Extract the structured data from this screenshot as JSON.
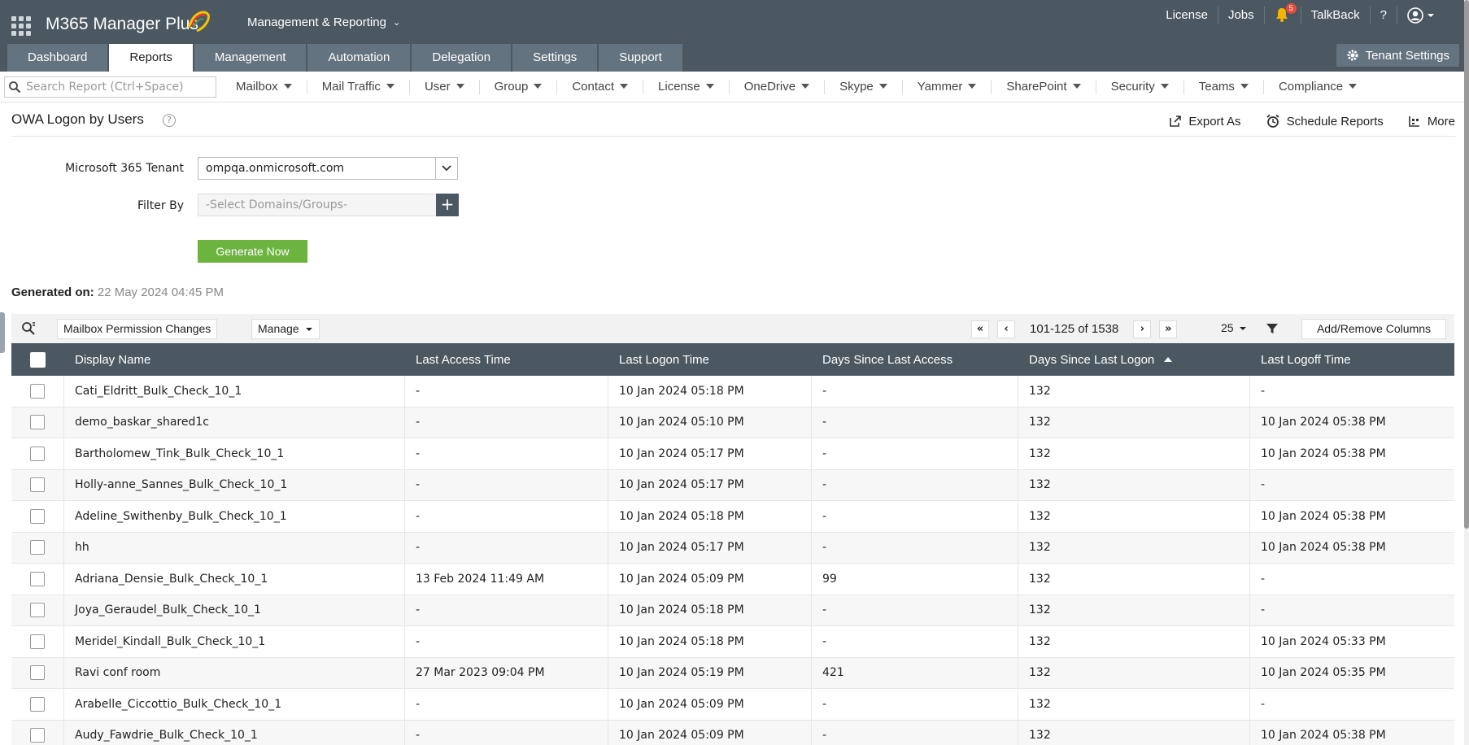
{
  "header": {
    "brand": "M365 Manager Plus",
    "module": "Management & Reporting",
    "links": [
      "License",
      "Jobs",
      "TalkBack",
      "?"
    ],
    "notification_count": "5",
    "tenant_settings": "Tenant Settings"
  },
  "tabs": [
    "Dashboard",
    "Reports",
    "Management",
    "Automation",
    "Delegation",
    "Settings",
    "Support"
  ],
  "subnav": {
    "search_placeholder": "Search Report (Ctrl+Space)",
    "items": [
      "Mailbox",
      "Mail Traffic",
      "User",
      "Group",
      "Contact",
      "License",
      "OneDrive",
      "Skype",
      "Yammer",
      "SharePoint",
      "Security",
      "Teams",
      "Compliance"
    ]
  },
  "page": {
    "title": "OWA Logon by Users",
    "actions": {
      "export": "Export As",
      "schedule": "Schedule Reports",
      "more": "More"
    }
  },
  "form": {
    "tenant_label": "Microsoft 365 Tenant",
    "tenant_value": "ompqa.onmicrosoft.com",
    "filter_label": "Filter By",
    "filter_placeholder": "-Select Domains/Groups-",
    "generate": "Generate Now",
    "generated_label": "Generated on:",
    "generated_value": "22 May 2024 04:45 PM"
  },
  "grid_toolbar": {
    "quick_filter": "Mailbox Permission Changes",
    "manage": "Manage",
    "range": "101-125 of 1538",
    "page_size": "25",
    "add_remove": "Add/Remove Columns"
  },
  "table": {
    "columns": [
      "Display Name",
      "Last Access Time",
      "Last Logon Time",
      "Days Since Last Access",
      "Days Since Last Logon",
      "Last Logoff Time"
    ],
    "rows": [
      [
        "Cati_Eldritt_Bulk_Check_10_1",
        "-",
        "10 Jan 2024 05:18 PM",
        "-",
        "132",
        "-"
      ],
      [
        "demo_baskar_shared1c",
        "-",
        "10 Jan 2024 05:10 PM",
        "-",
        "132",
        "10 Jan 2024 05:38 PM"
      ],
      [
        "Bartholomew_Tink_Bulk_Check_10_1",
        "-",
        "10 Jan 2024 05:17 PM",
        "-",
        "132",
        "10 Jan 2024 05:38 PM"
      ],
      [
        "Holly-anne_Sannes_Bulk_Check_10_1",
        "-",
        "10 Jan 2024 05:17 PM",
        "-",
        "132",
        "-"
      ],
      [
        "Adeline_Swithenby_Bulk_Check_10_1",
        "-",
        "10 Jan 2024 05:18 PM",
        "-",
        "132",
        "10 Jan 2024 05:38 PM"
      ],
      [
        "hh",
        "-",
        "10 Jan 2024 05:17 PM",
        "-",
        "132",
        "10 Jan 2024 05:38 PM"
      ],
      [
        "Adriana_Densie_Bulk_Check_10_1",
        "13 Feb 2024 11:49 AM",
        "10 Jan 2024 05:09 PM",
        "99",
        "132",
        "-"
      ],
      [
        "Joya_Geraudel_Bulk_Check_10_1",
        "-",
        "10 Jan 2024 05:18 PM",
        "-",
        "132",
        "-"
      ],
      [
        "Meridel_Kindall_Bulk_Check_10_1",
        "-",
        "10 Jan 2024 05:18 PM",
        "-",
        "132",
        "10 Jan 2024 05:33 PM"
      ],
      [
        "Ravi conf room",
        "27 Mar 2023 09:04 PM",
        "10 Jan 2024 05:19 PM",
        "421",
        "132",
        "10 Jan 2024 05:35 PM"
      ],
      [
        "Arabelle_Ciccottio_Bulk_Check_10_1",
        "-",
        "10 Jan 2024 05:09 PM",
        "-",
        "132",
        "-"
      ],
      [
        "Audy_Fawdrie_Bulk_Check_10_1",
        "-",
        "10 Jan 2024 05:09 PM",
        "-",
        "132",
        "10 Jan 2024 05:38 PM"
      ]
    ]
  }
}
